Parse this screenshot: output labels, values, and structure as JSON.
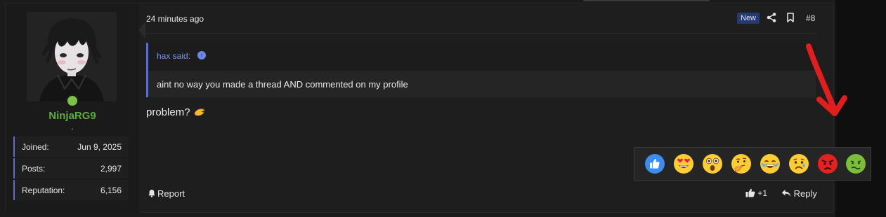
{
  "user": {
    "username": "NinjaRG9",
    "title": ".",
    "stats": [
      {
        "label": "Joined:",
        "value": "Jun 9, 2025"
      },
      {
        "label": "Posts:",
        "value": "2,997"
      },
      {
        "label": "Reputation:",
        "value": "6,156"
      }
    ],
    "online_color": "#7cc343"
  },
  "post": {
    "time": "24 minutes ago",
    "new_badge": "New",
    "number": "#8",
    "quote": {
      "author": "hax said:",
      "text": "aint no way you made a thread AND commented on my profile"
    },
    "message": "problem?",
    "report_label": "Report",
    "like_count": "+1",
    "reply_label": "Reply"
  },
  "reactions": [
    {
      "name": "like-reaction",
      "icon": "thumbs-up"
    },
    {
      "name": "love-reaction",
      "icon": "heart-eyes"
    },
    {
      "name": "wow-reaction",
      "icon": "astonished"
    },
    {
      "name": "thinking-reaction",
      "icon": "thinking"
    },
    {
      "name": "haha-reaction",
      "icon": "tears-of-joy"
    },
    {
      "name": "sad-reaction",
      "icon": "sad"
    },
    {
      "name": "angry-reaction",
      "icon": "angry"
    },
    {
      "name": "sick-reaction",
      "icon": "nauseated"
    }
  ],
  "colors": {
    "accent": "#5b6cc9",
    "username": "#5fad3b",
    "new_badge_bg": "#253a6e",
    "annotation_arrow": "#e01e1e"
  }
}
